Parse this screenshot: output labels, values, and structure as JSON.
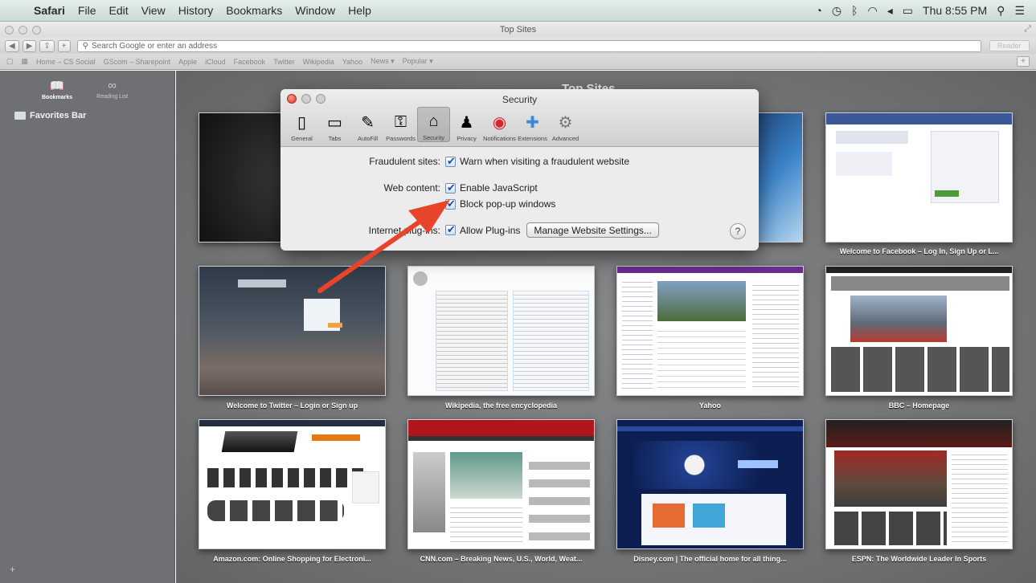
{
  "menubar": {
    "app": "Safari",
    "items": [
      "File",
      "Edit",
      "View",
      "History",
      "Bookmarks",
      "Window",
      "Help"
    ],
    "clock": "Thu 8:55 PM"
  },
  "window": {
    "title": "Top Sites"
  },
  "toolbar": {
    "address_placeholder": "Search Google or enter an address",
    "reader": "Reader"
  },
  "bookmarks_bar": [
    "Home – CS Social",
    "GScom – Sharepoint",
    "Apple",
    "iCloud",
    "Facebook",
    "Twitter",
    "Wikipedia",
    "Yahoo",
    "News ▾",
    "Popular ▾"
  ],
  "sidebar": {
    "tab_bookmarks": "Bookmarks",
    "tab_reading": "Reading List",
    "favorites": "Favorites Bar"
  },
  "top_sites": {
    "title": "Top Sites",
    "captions": [
      "Welcome to Facebook – Log In, Sign Up or L...",
      "Welcome to Twitter – Login or Sign up",
      "Wikipedia, the free encyclopedia",
      "Yahoo",
      "BBC – Homepage",
      "Amazon.com: Online Shopping for Electroni...",
      "CNN.com – Breaking News, U.S., World, Weat...",
      "Disney.com | The official home for all thing...",
      "ESPN: The Worldwide Leader In Sports"
    ]
  },
  "dialog": {
    "title": "Security",
    "tabs": [
      "General",
      "Tabs",
      "AutoFill",
      "Passwords",
      "Security",
      "Privacy",
      "Notifications",
      "Extensions",
      "Advanced"
    ],
    "active_tab": "Security",
    "fraudulent_label": "Fraudulent sites:",
    "fraudulent_check": "Warn when visiting a fraudulent website",
    "web_content_label": "Web content:",
    "js_check": "Enable JavaScript",
    "popup_check": "Block pop-up windows",
    "plugins_label": "Internet plug-ins:",
    "plugins_check": "Allow Plug-ins",
    "manage_button": "Manage Website Settings...",
    "help": "?"
  },
  "colors": {
    "arrow": "#e8432b",
    "sidebar": "#6e7073",
    "menubar": "#d6e5de"
  }
}
